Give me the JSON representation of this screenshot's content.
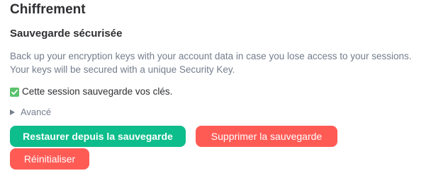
{
  "section": {
    "title": "Chiffrement"
  },
  "secure_backup": {
    "title": "Sauvegarde sécurisée",
    "description": "Back up your encryption keys with your account data in case you lose access to your sessions. Your keys will be secured with a unique Security Key.",
    "status_icon": "check-icon",
    "status_text": "Cette session sauvegarde vos clés.",
    "advanced_label": "Avancé",
    "buttons": {
      "restore": "Restaurer depuis la sauvegarde",
      "delete": "Supprimer la sauvegarde",
      "reset": "Réinitialiser"
    }
  },
  "colors": {
    "accent": "#0dbd8b",
    "danger": "#ff5b55",
    "check": "#5ac26b",
    "secondary_text": "#737d8c",
    "primary_text": "#2e2f32"
  }
}
